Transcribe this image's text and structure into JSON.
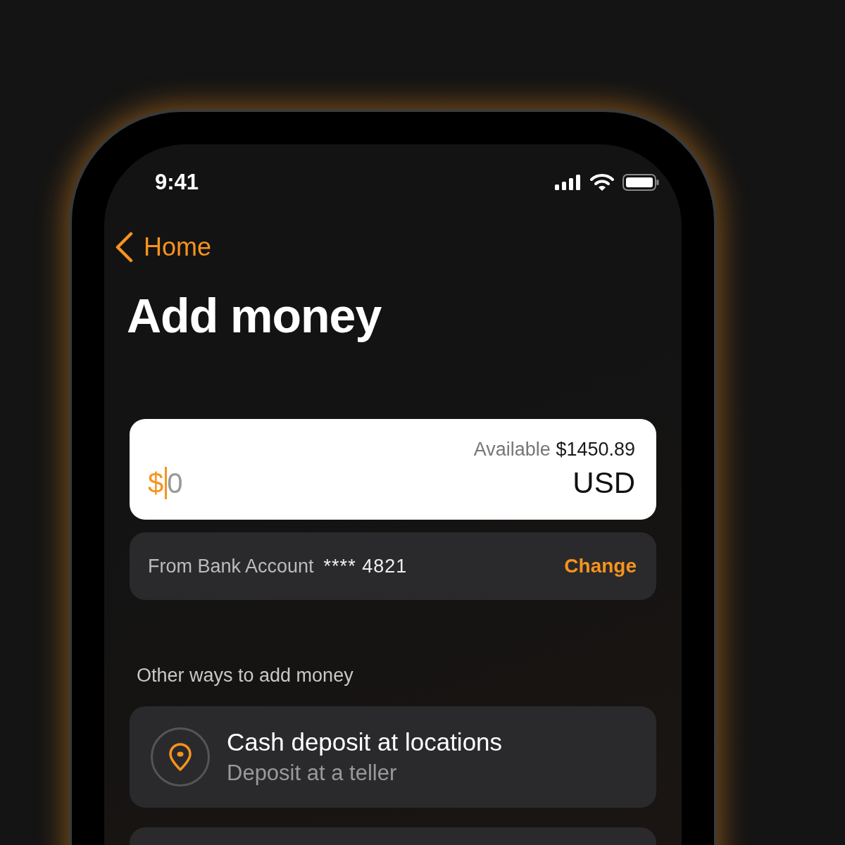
{
  "status_bar": {
    "time": "9:41"
  },
  "nav": {
    "back_label": "Home"
  },
  "title": "Add money",
  "amount_card": {
    "currency_symbol": "$",
    "placeholder": "0",
    "available_label": "Available",
    "available_amount": "$1450.89",
    "currency": "USD"
  },
  "bank_row": {
    "label": "From Bank Account",
    "account": "**** 4821",
    "action": "Change"
  },
  "section_heading": "Other ways to add money",
  "options": [
    {
      "kind": "location",
      "title": "Cash deposit at locations",
      "subtitle": "Deposit at a teller"
    }
  ]
}
